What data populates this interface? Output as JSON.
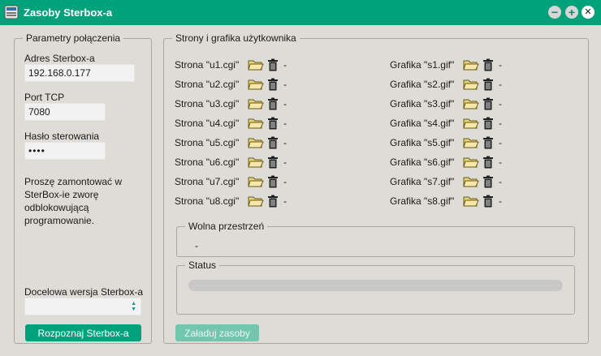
{
  "window": {
    "title": "Zasoby Sterbox-a"
  },
  "connection": {
    "legend": "Parametry połączenia",
    "address_label": "Adres Sterbox-a",
    "address_value": "192.168.0.177",
    "port_label": "Port TCP",
    "port_value": "7080",
    "password_label": "Hasło sterowania",
    "password_value": "••••",
    "note": "Proszę zamontować w SterBox-ie zworę odblokowującą programowanie.",
    "version_label": "Docelowa wersja Sterbox-a",
    "version_value": "",
    "detect_button": "Rozpoznaj Sterbox-a"
  },
  "resources": {
    "legend": "Strony i grafika użytkownika",
    "pages": [
      {
        "name": "Strona \"u1.cgi\"",
        "value": "-"
      },
      {
        "name": "Strona \"u2.cgi\"",
        "value": "-"
      },
      {
        "name": "Strona \"u3.cgi\"",
        "value": "-"
      },
      {
        "name": "Strona \"u4.cgi\"",
        "value": "-"
      },
      {
        "name": "Strona \"u5.cgi\"",
        "value": "-"
      },
      {
        "name": "Strona \"u6.cgi\"",
        "value": "-"
      },
      {
        "name": "Strona \"u7.cgi\"",
        "value": "-"
      },
      {
        "name": "Strona \"u8.cgi\"",
        "value": "-"
      }
    ],
    "graphics": [
      {
        "name": "Grafika \"s1.gif\"",
        "value": "-"
      },
      {
        "name": "Grafika \"s2.gif\"",
        "value": "-"
      },
      {
        "name": "Grafika \"s3.gif\"",
        "value": "-"
      },
      {
        "name": "Grafika \"s4.gif\"",
        "value": "-"
      },
      {
        "name": "Grafika \"s5.gif\"",
        "value": "-"
      },
      {
        "name": "Grafika \"s6.gif\"",
        "value": "-"
      },
      {
        "name": "Grafika \"s7.gif\"",
        "value": "-"
      },
      {
        "name": "Grafika \"s8.gif\"",
        "value": "-"
      }
    ],
    "free_space_legend": "Wolna przestrzeń",
    "free_space_value": "-",
    "status_legend": "Status",
    "status_progress": 0,
    "load_button": "Załaduj zasoby"
  },
  "colors": {
    "accent": "#00a27b",
    "accent_disabled": "#73c6ae",
    "background": "#dedcd6"
  },
  "icons": [
    "app-icon",
    "minimize-icon",
    "maximize-icon",
    "close-icon",
    "folder-open-icon",
    "trash-icon",
    "spinner-arrows-icon"
  ]
}
